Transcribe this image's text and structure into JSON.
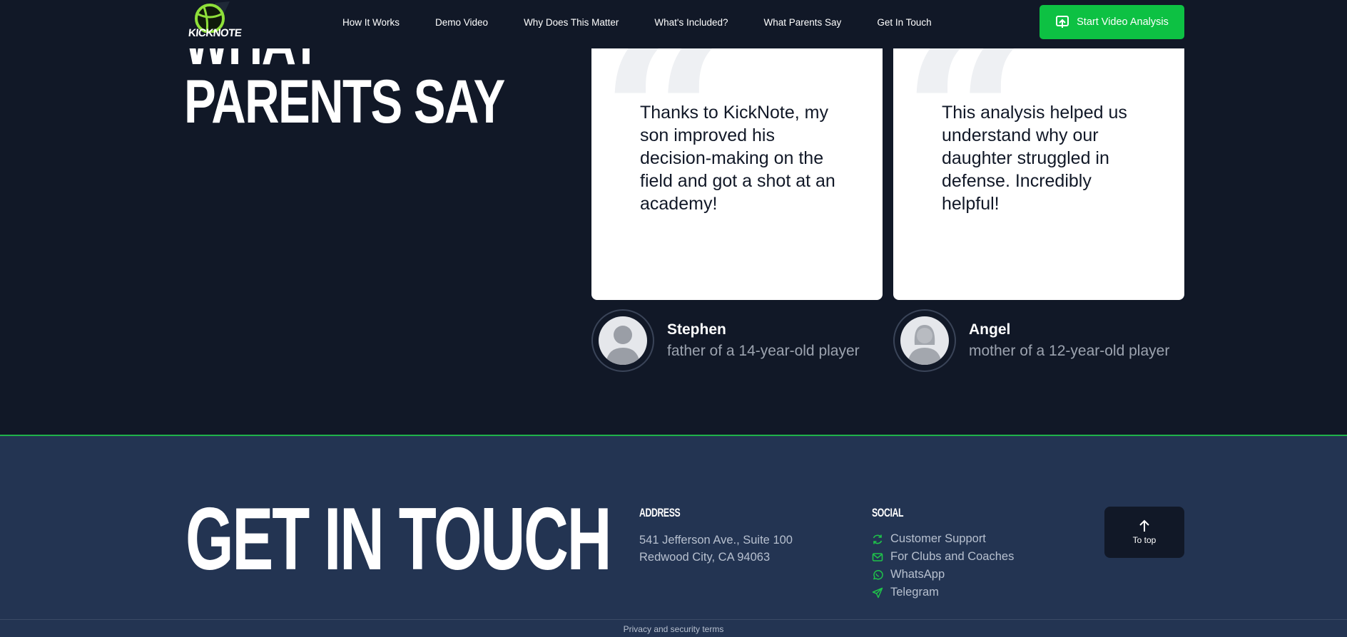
{
  "header": {
    "logo_text": "KICKNOTE",
    "nav": [
      "How It Works",
      "Demo Video",
      "Why Does This Matter",
      "What's Included?",
      "What Parents Say",
      "Get In Touch"
    ],
    "cta_label": "Start Video Analysis",
    "cta_icon": "upload-icon",
    "accent_color": "#0dc143"
  },
  "testimonials": {
    "title_line1": "WHAT",
    "title_line2": "PARENTS SAY",
    "items": [
      {
        "quote": "Thanks to KickNote, my son improved his decision-making on the field and got a shot at an academy!",
        "name": "Stephen",
        "role": "father of a 14-year-old player"
      },
      {
        "quote": "This analysis helped us understand why our daughter struggled in defense. Incredibly helpful!",
        "name": "Angel",
        "role": "mother of a 12-year-old player"
      }
    ]
  },
  "footer": {
    "title": "GET IN TOUCH",
    "address_heading": "ADDRESS",
    "address_line1": "541 Jefferson Ave., Suite 100",
    "address_line2": "Redwood City, CA 94063",
    "social_heading": "SOCIAL",
    "social": [
      {
        "label": "Customer Support",
        "icon": "refresh-icon"
      },
      {
        "label": "For Clubs and Coaches",
        "icon": "mail-icon"
      },
      {
        "label": "WhatsApp",
        "icon": "whatsapp-icon"
      },
      {
        "label": "Telegram",
        "icon": "telegram-icon"
      }
    ],
    "to_top_label": "To top",
    "privacy_label": "Privacy and security terms"
  }
}
